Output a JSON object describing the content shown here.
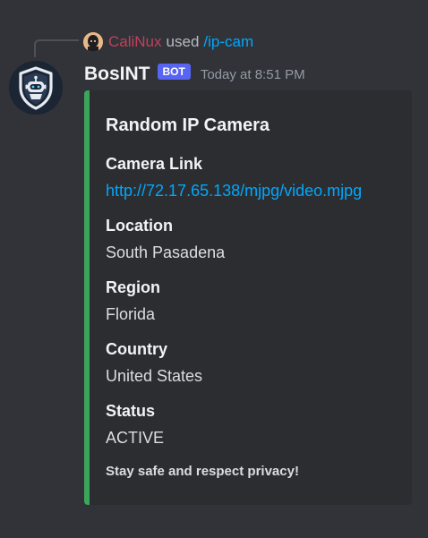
{
  "reply": {
    "user": "CaliNux",
    "action": "used",
    "command": "/ip-cam"
  },
  "message": {
    "author": "BosINT",
    "bot_tag": "BOT",
    "timestamp": "Today at 8:51 PM"
  },
  "embed": {
    "accent_color": "#3ba55c",
    "title": "Random IP Camera",
    "fields": [
      {
        "name": "Camera Link",
        "value": "http://72.17.65.138/mjpg/video.mjpg"
      },
      {
        "name": "Location",
        "value": "South Pasadena"
      },
      {
        "name": "Region",
        "value": "Florida"
      },
      {
        "name": "Country",
        "value": "United States"
      },
      {
        "name": "Status",
        "value": "ACTIVE"
      }
    ],
    "footer": "Stay safe and respect privacy!"
  },
  "colors": {
    "background": "#313338",
    "embed_background": "#2b2d31",
    "link": "#00a8fc",
    "reply_user": "#c0405c",
    "bot_tag": "#5865f2"
  },
  "icons": {
    "reply_avatar": "user-avatar-icon",
    "bot_avatar": "robot-shield-icon"
  }
}
